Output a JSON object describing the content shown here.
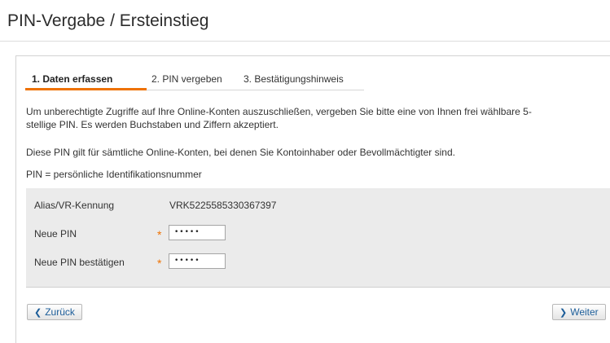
{
  "page": {
    "title": "PIN-Vergabe / Ersteinstieg"
  },
  "tabs": [
    {
      "label": "1. Daten erfassen",
      "active": true
    },
    {
      "label": "2. PIN vergeben",
      "active": false
    },
    {
      "label": "3. Bestätigungshinweis",
      "active": false
    }
  ],
  "info": {
    "line1a": "Um unberechtigte Zugriffe auf Ihre Online-Konten auszuschließen, vergeben Sie bitte eine von Ihnen frei wählbare 5-",
    "line1b": "stellige PIN. Es werden Buchstaben und Ziffern akzeptiert.",
    "line2": "Diese PIN gilt für sämtliche Online-Konten, bei denen Sie Kontoinhaber oder Bevollmächtigter sind.",
    "line3": "PIN = persönliche Identifikationsnummer"
  },
  "form": {
    "alias_label": "Alias/VR-Kennung",
    "alias_value": "VRK5225585330367397",
    "new_pin_label": "Neue PIN",
    "new_pin_value": "•••••",
    "confirm_pin_label": "Neue PIN bestätigen",
    "confirm_pin_value": "•••••",
    "required_marker": "*"
  },
  "buttons": {
    "back_label": "Zurück",
    "next_label": "Weiter",
    "back_icon": "chevron-left",
    "next_icon": "chevron-right"
  },
  "colors": {
    "accent": "#ee7203",
    "link": "#1c5d99",
    "form_bg": "#ebebeb"
  }
}
